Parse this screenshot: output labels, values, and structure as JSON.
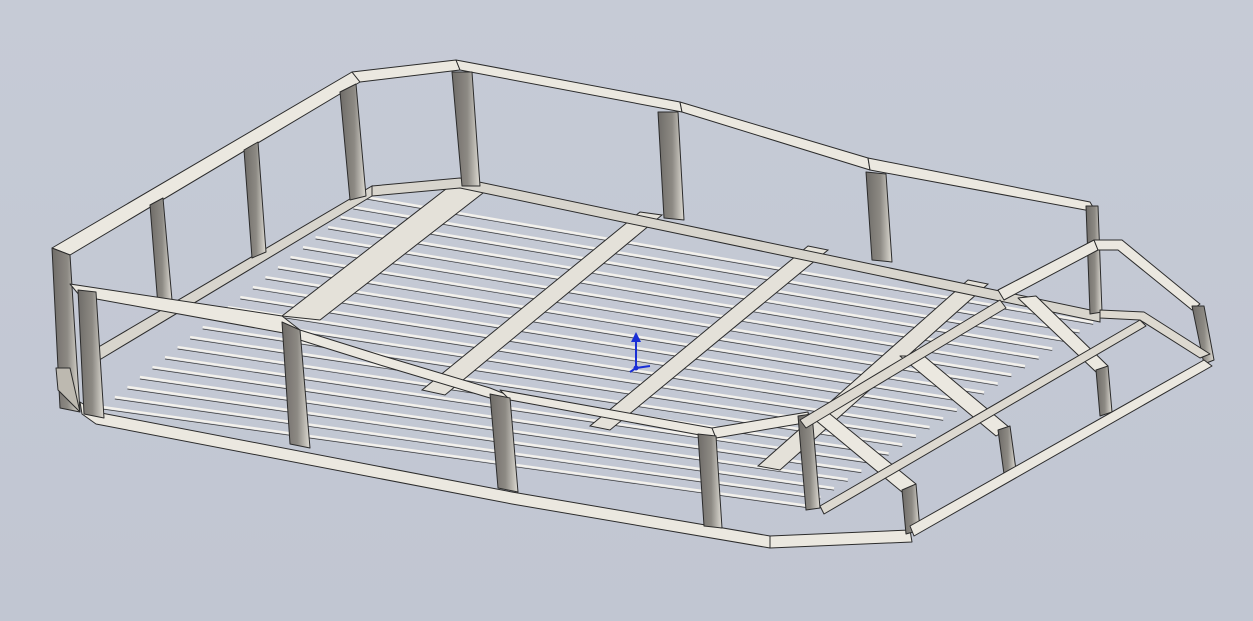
{
  "viewport": {
    "background_color": "#c3c8d4",
    "model_edge_color": "#2b2b2b",
    "model_face_light": "#e9e6de",
    "model_face_shade": "#8d8a84",
    "model_face_dark": "#6f6c68"
  },
  "triad": {
    "icon": "coordinate-triad-icon",
    "color": "#1a2fd6"
  }
}
